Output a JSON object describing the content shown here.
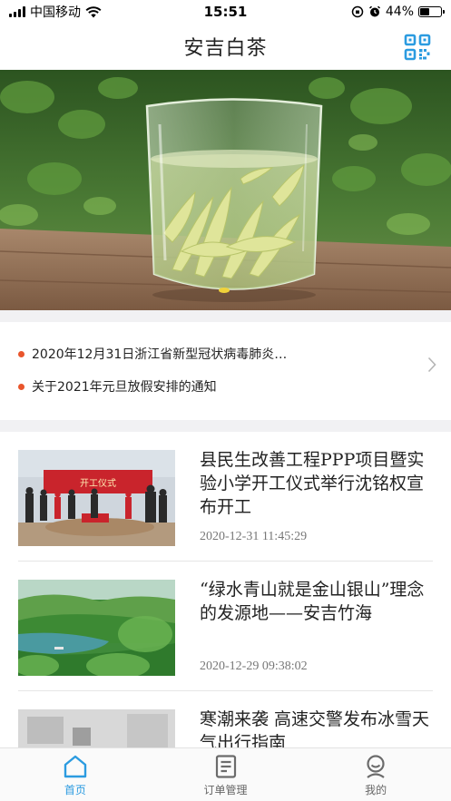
{
  "status_bar": {
    "carrier": "中国移动",
    "time": "15:51",
    "battery": "44%",
    "battery_level": 0.44
  },
  "header": {
    "title": "安吉白茶",
    "qr_icon": "qr-code-icon"
  },
  "notices": [
    {
      "text": "2020年12月31日浙江省新型冠状病毒肺炎…"
    },
    {
      "text": "关于2021年元旦放假安排的通知"
    }
  ],
  "news": [
    {
      "title": "县民生改善工程PPP项目暨实验小学开工仪式举行沈铭权宣布开工",
      "date": "2020-12-31 11:45:29",
      "thumb_banner": "开工仪式"
    },
    {
      "title": "“绿水青山就是金山银山”理念的发源地——安吉竹海",
      "date": "2020-12-29 09:38:02"
    },
    {
      "title": "寒潮来袭 高速交警发布冰雪天气出行指南",
      "date": ""
    }
  ],
  "tabbar": {
    "items": [
      {
        "label": "首页",
        "icon": "home-icon",
        "active": true
      },
      {
        "label": "订单管理",
        "icon": "order-list-icon",
        "active": false
      },
      {
        "label": "我的",
        "icon": "profile-icon",
        "active": false
      }
    ]
  },
  "colors": {
    "accent": "#2b9be0",
    "notice_dot": "#e9552c",
    "divider": "#f1f1f3"
  }
}
